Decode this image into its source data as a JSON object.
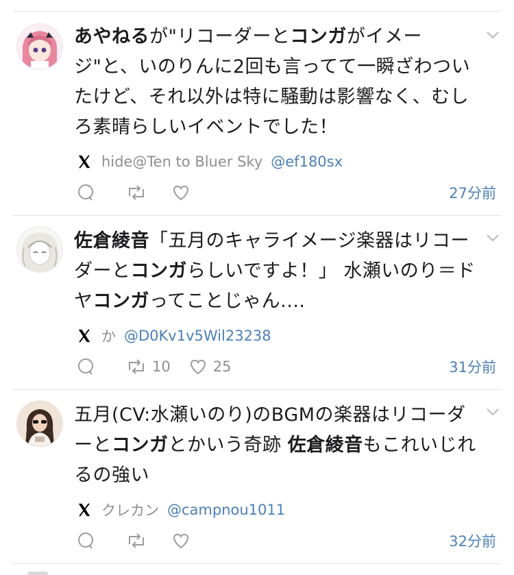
{
  "tweets": [
    {
      "segments": [
        {
          "t": "あやねる",
          "b": true
        },
        {
          "t": "が\"リコーダーと",
          "b": false
        },
        {
          "t": "コンガ",
          "b": true
        },
        {
          "t": "がイメージ\"と、いのりんに2回も言ってて一瞬ざわついたけど、それ以外は特に騒動は影響なく、むしろ素晴らしいイベントでした！",
          "b": false
        }
      ],
      "source_name": "hide@Ten to Bluer Sky",
      "source_handle": "@ef180sx",
      "retweets": "",
      "likes": "",
      "time": "27分前"
    },
    {
      "segments": [
        {
          "t": "佐倉綾音",
          "b": true
        },
        {
          "t": "「五月のキャライメージ楽器はリコーダーと",
          "b": false
        },
        {
          "t": "コンガ",
          "b": true
        },
        {
          "t": "らしいですよ！」 水瀬いのり＝ドヤ",
          "b": false
        },
        {
          "t": "コンガ",
          "b": true
        },
        {
          "t": "ってことじゃん....",
          "b": false
        }
      ],
      "source_name": "か",
      "source_handle": "@D0Kv1v5Wil23238",
      "retweets": "10",
      "likes": "25",
      "time": "31分前"
    },
    {
      "segments": [
        {
          "t": "五月(CV:水瀬いのり)のBGMの楽器はリコーダーと",
          "b": false
        },
        {
          "t": "コンガ",
          "b": true
        },
        {
          "t": "とかいう奇跡 ",
          "b": false
        },
        {
          "t": "佐倉綾音",
          "b": true
        },
        {
          "t": "もこれいじれるの強い",
          "b": false
        }
      ],
      "source_name": "クレカン",
      "source_handle": "@campnou1011",
      "retweets": "",
      "likes": "",
      "time": "32分前"
    }
  ],
  "icons": {
    "source": "x-logo-icon",
    "reply": "reply-icon",
    "retweet": "retweet-icon",
    "like": "heart-icon",
    "menu": "chevron-down-icon"
  },
  "colors": {
    "link": "#4a7fb7",
    "muted": "#8e8e93",
    "divider": "#e2e2e6",
    "text": "#1c1c1e"
  }
}
